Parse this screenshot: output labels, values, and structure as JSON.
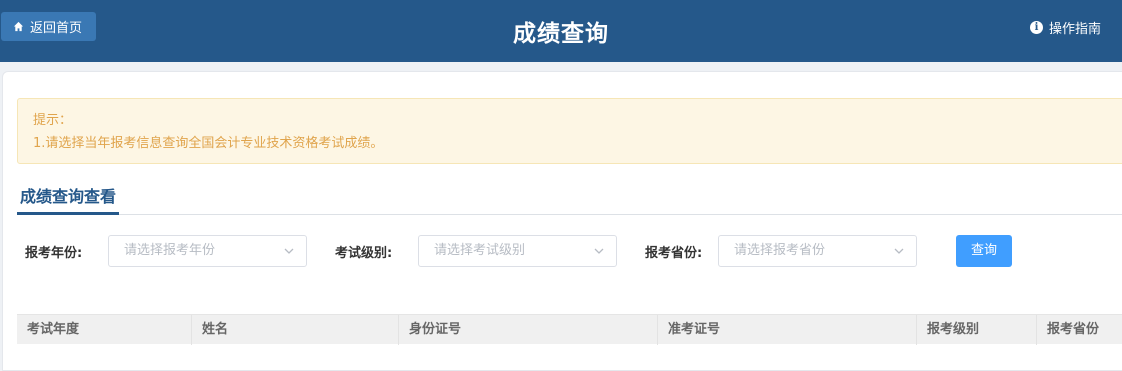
{
  "header": {
    "home_label": "返回首页",
    "title": "成绩查询",
    "guide_label": "操作指南",
    "bg_color": "#25588a"
  },
  "tip": {
    "title": "提示：",
    "line1": "1.请选择当年报考信息查询全国会计专业技术资格考试成绩。"
  },
  "tab": {
    "label": "成绩查询查看"
  },
  "filters": {
    "year_label": "报考年份:",
    "year_placeholder": "请选择报考年份",
    "level_label": "考试级别:",
    "level_placeholder": "请选择考试级别",
    "province_label": "报考省份:",
    "province_placeholder": "请选择报考省份",
    "query_label": "查询"
  },
  "table": {
    "columns": [
      "考试年度",
      "姓名",
      "身份证号",
      "准考证号",
      "报考级别",
      "报考省份"
    ]
  },
  "icons": {
    "home": "home-icon",
    "info": "info-icon",
    "chevron": "chevron-down-icon"
  }
}
